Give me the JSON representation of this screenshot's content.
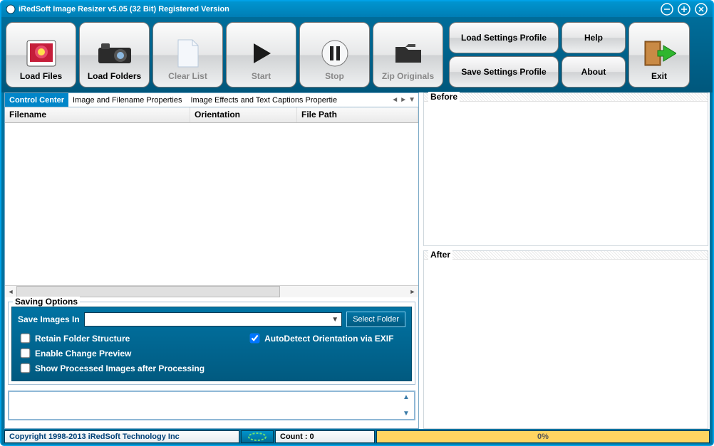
{
  "title": "iRedSoft Image Resizer v5.05 (32 Bit) Registered Version",
  "toolbar": {
    "load_files": "Load Files",
    "load_folders": "Load Folders",
    "clear_list": "Clear List",
    "start": "Start",
    "stop": "Stop",
    "zip_originals": "Zip Originals",
    "load_profile": "Load Settings Profile",
    "save_profile": "Save Settings Profile",
    "help": "Help",
    "about": "About",
    "exit": "Exit"
  },
  "tabs": {
    "control_center": "Control Center",
    "image_props": "Image and Filename Properties",
    "effects": "Image Effects and Text Captions Propertie"
  },
  "grid": {
    "col_filename": "Filename",
    "col_orientation": "Orientation",
    "col_filepath": "File Path"
  },
  "saving": {
    "legend": "Saving Options",
    "save_in_label": "Save Images In",
    "path_value": "",
    "select_folder": "Select Folder",
    "retain": "Retain Folder Structure",
    "preview": "Enable Change Preview",
    "show_processed": "Show Processed Images after Processing",
    "autodetect": "AutoDetect Orientation via EXIF"
  },
  "preview": {
    "before": "Before",
    "after": "After"
  },
  "status": {
    "copyright": "Copyright 1998-2013 iRedSoft Technology Inc",
    "count_label": "Count : 0",
    "progress_text": "0%"
  }
}
